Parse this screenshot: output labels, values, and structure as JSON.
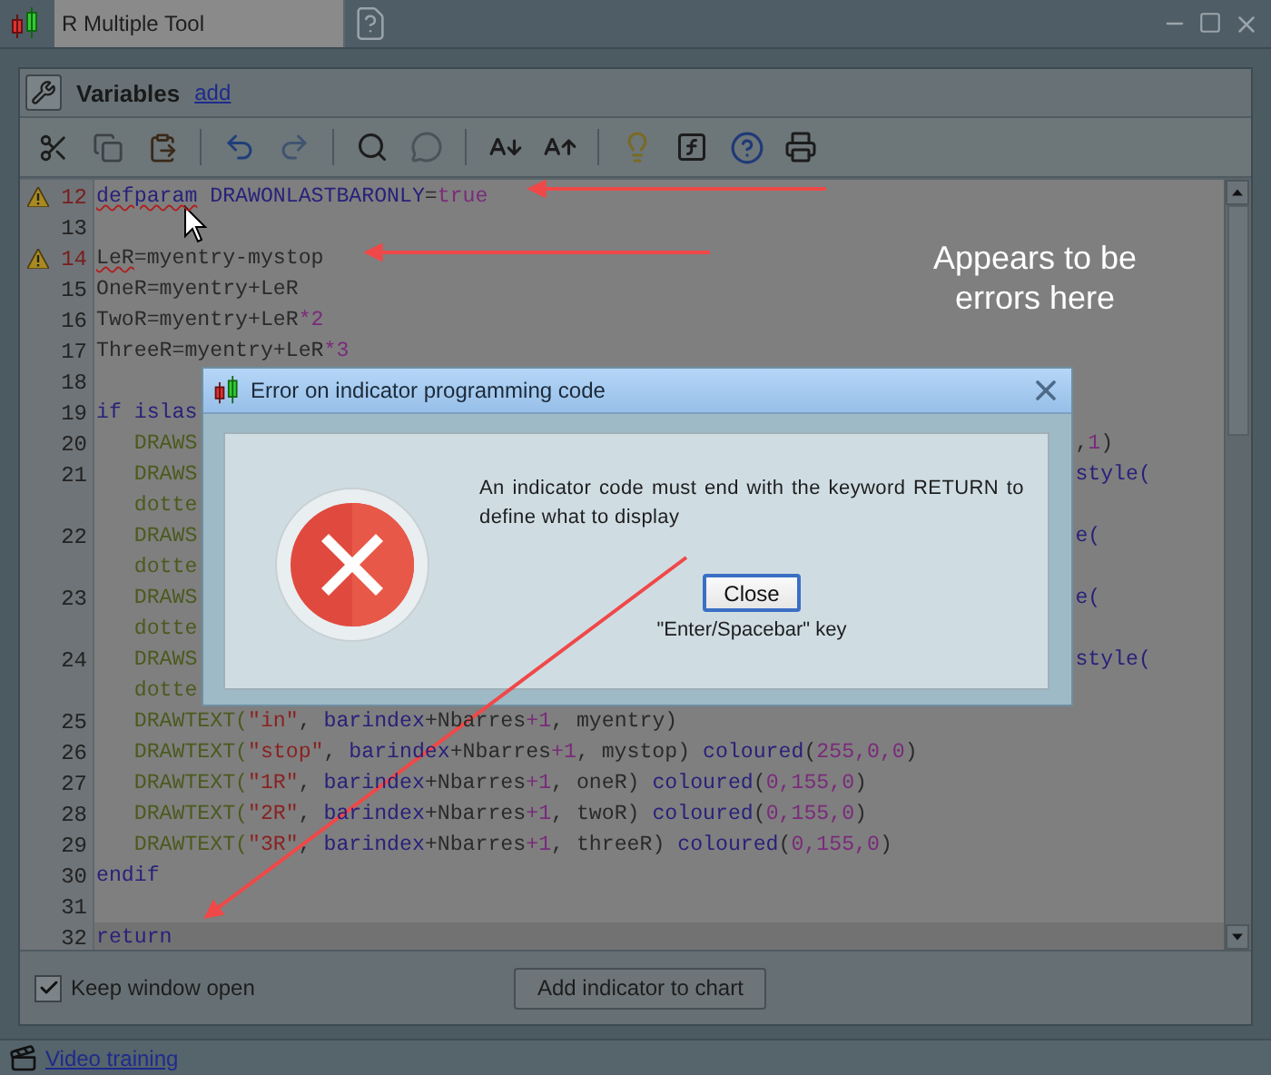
{
  "window": {
    "title": "R Multiple Tool"
  },
  "variables": {
    "label": "Variables",
    "link": "add"
  },
  "editor": {
    "lines": [
      {
        "number": "12",
        "warning": true,
        "tokens": [
          {
            "text": "defparam",
            "kind": "keyword",
            "error": true
          },
          {
            "text": " DRAWONLASTBARONLY",
            "kind": "keyword"
          },
          {
            "text": "=",
            "kind": "plain"
          },
          {
            "text": "true",
            "kind": "number"
          }
        ]
      },
      {
        "number": "13",
        "warning": false
      },
      {
        "number": "14",
        "warning": true,
        "tokens": [
          {
            "text": "LeR",
            "kind": "plain",
            "error": true
          },
          {
            "text": "=myentry-mystop",
            "kind": "plain"
          }
        ]
      },
      {
        "number": "15",
        "warning": false,
        "tokens": [
          {
            "text": "OneR=myentry+LeR",
            "kind": "plain"
          }
        ]
      },
      {
        "number": "16",
        "warning": false,
        "tokens": [
          {
            "text": "TwoR=myentry+LeR",
            "kind": "plain"
          },
          {
            "text": "*2",
            "kind": "number"
          }
        ]
      },
      {
        "number": "17",
        "warning": false,
        "tokens": [
          {
            "text": "ThreeR=myentry+LeR",
            "kind": "plain"
          },
          {
            "text": "*3",
            "kind": "number"
          }
        ]
      },
      {
        "number": "18",
        "warning": false
      },
      {
        "number": "19",
        "warning": false,
        "tokens": [
          {
            "text": "if islas",
            "kind": "keyword"
          }
        ]
      },
      {
        "number": "20",
        "warning": false,
        "tokens": [
          {
            "text": "   DRAWS",
            "kind": "function"
          }
        ],
        "right": [
          {
            "text": ",",
            "kind": "plain"
          },
          {
            "text": "1",
            "kind": "number"
          },
          {
            "text": ")",
            "kind": "plain"
          }
        ]
      },
      {
        "number": "21",
        "warning": false,
        "tokens": [
          {
            "text": "   DRAWS",
            "kind": "function"
          }
        ],
        "right": [
          {
            "text": "style(",
            "kind": "keyword"
          }
        ]
      },
      {
        "warning": false,
        "tokens": [
          {
            "text": "   dotte",
            "kind": "function"
          }
        ]
      },
      {
        "number": "22",
        "warning": false,
        "tokens": [
          {
            "text": "   DRAWS",
            "kind": "function"
          }
        ],
        "right": [
          {
            "text": "e(",
            "kind": "keyword"
          }
        ]
      },
      {
        "warning": false,
        "tokens": [
          {
            "text": "   dotte",
            "kind": "function"
          }
        ]
      },
      {
        "number": "23",
        "warning": false,
        "tokens": [
          {
            "text": "   DRAWS",
            "kind": "function"
          }
        ],
        "right": [
          {
            "text": "e(",
            "kind": "keyword"
          }
        ]
      },
      {
        "warning": false,
        "tokens": [
          {
            "text": "   dotte",
            "kind": "function"
          }
        ]
      },
      {
        "number": "24",
        "warning": false,
        "tokens": [
          {
            "text": "   DRAWS",
            "kind": "function"
          }
        ],
        "right": [
          {
            "text": "style(",
            "kind": "keyword"
          }
        ]
      },
      {
        "warning": false,
        "tokens": [
          {
            "text": "   dotte",
            "kind": "function"
          }
        ]
      },
      {
        "number": "25",
        "warning": false,
        "tokens": [
          {
            "text": "   DRAWTEXT(",
            "kind": "function"
          },
          {
            "text": "\"in\"",
            "kind": "string"
          },
          {
            "text": ", ",
            "kind": "plain"
          },
          {
            "text": "barindex",
            "kind": "keyword"
          },
          {
            "text": "+Nbarres",
            "kind": "plain"
          },
          {
            "text": "+1",
            "kind": "number"
          },
          {
            "text": ", myentry)",
            "kind": "plain"
          }
        ]
      },
      {
        "number": "26",
        "warning": false,
        "tokens": [
          {
            "text": "   DRAWTEXT(",
            "kind": "function"
          },
          {
            "text": "\"stop\"",
            "kind": "string"
          },
          {
            "text": ", ",
            "kind": "plain"
          },
          {
            "text": "barindex",
            "kind": "keyword"
          },
          {
            "text": "+Nbarres",
            "kind": "plain"
          },
          {
            "text": "+1",
            "kind": "number"
          },
          {
            "text": ", mystop) ",
            "kind": "plain"
          },
          {
            "text": "coloured",
            "kind": "keyword"
          },
          {
            "text": "(",
            "kind": "plain"
          },
          {
            "text": "255,0,0",
            "kind": "number"
          },
          {
            "text": ")",
            "kind": "plain"
          }
        ]
      },
      {
        "number": "27",
        "warning": false,
        "tokens": [
          {
            "text": "   DRAWTEXT(",
            "kind": "function"
          },
          {
            "text": "\"1R\"",
            "kind": "string"
          },
          {
            "text": ", ",
            "kind": "plain"
          },
          {
            "text": "barindex",
            "kind": "keyword"
          },
          {
            "text": "+Nbarres",
            "kind": "plain"
          },
          {
            "text": "+1",
            "kind": "number"
          },
          {
            "text": ", oneR) ",
            "kind": "plain"
          },
          {
            "text": "coloured",
            "kind": "keyword"
          },
          {
            "text": "(",
            "kind": "plain"
          },
          {
            "text": "0,155,0",
            "kind": "number"
          },
          {
            "text": ")",
            "kind": "plain"
          }
        ]
      },
      {
        "number": "28",
        "warning": false,
        "tokens": [
          {
            "text": "   DRAWTEXT(",
            "kind": "function"
          },
          {
            "text": "\"2R\"",
            "kind": "string"
          },
          {
            "text": ", ",
            "kind": "plain"
          },
          {
            "text": "barindex",
            "kind": "keyword"
          },
          {
            "text": "+Nbarres",
            "kind": "plain"
          },
          {
            "text": "+1",
            "kind": "number"
          },
          {
            "text": ", twoR) ",
            "kind": "plain"
          },
          {
            "text": "coloured",
            "kind": "keyword"
          },
          {
            "text": "(",
            "kind": "plain"
          },
          {
            "text": "0,155,0",
            "kind": "number"
          },
          {
            "text": ")",
            "kind": "plain"
          }
        ]
      },
      {
        "number": "29",
        "warning": false,
        "tokens": [
          {
            "text": "   DRAWTEXT(",
            "kind": "function"
          },
          {
            "text": "\"3R\"",
            "kind": "string"
          },
          {
            "text": ", ",
            "kind": "plain"
          },
          {
            "text": "barindex",
            "kind": "keyword"
          },
          {
            "text": "+Nbarres",
            "kind": "plain"
          },
          {
            "text": "+1",
            "kind": "number"
          },
          {
            "text": ", threeR) ",
            "kind": "plain"
          },
          {
            "text": "coloured",
            "kind": "keyword"
          },
          {
            "text": "(",
            "kind": "plain"
          },
          {
            "text": "0,155,0",
            "kind": "number"
          },
          {
            "text": ")",
            "kind": "plain"
          }
        ]
      },
      {
        "number": "30",
        "warning": false,
        "tokens": [
          {
            "text": "endif",
            "kind": "keyword"
          }
        ]
      },
      {
        "number": "31",
        "warning": false
      },
      {
        "number": "32",
        "warning": false,
        "current": true,
        "tokens": [
          {
            "text": "return",
            "kind": "keyword"
          }
        ]
      }
    ]
  },
  "keep_open": {
    "label": "Keep window open",
    "checked": true
  },
  "add_button": "Add indicator to chart",
  "status_bar": {
    "link": "Video training"
  },
  "dialog": {
    "title": "Error on indicator programming code",
    "message": "An indicator code must end with the keyword RETURN to define what to display",
    "button": "Close",
    "hint": "\"Enter/Spacebar\" key"
  },
  "annotation": {
    "text": "Appears to be errors here"
  }
}
